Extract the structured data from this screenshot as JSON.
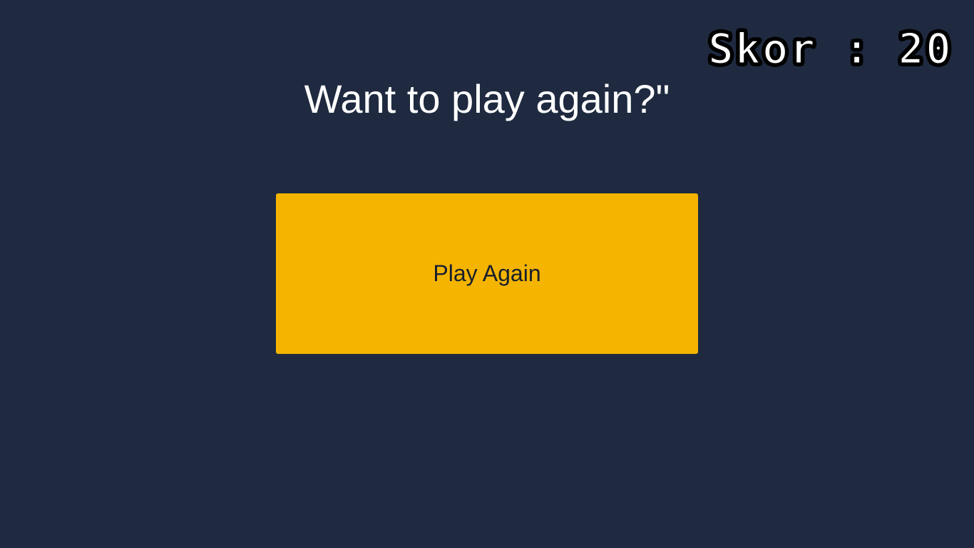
{
  "hud": {
    "score_text": "Skor : 20"
  },
  "dialog": {
    "title": "Want to play again?\"",
    "play_again_label": "Play Again"
  },
  "colors": {
    "background": "#1f2a40",
    "button": "#f4b400",
    "button_text": "#1a1f2e",
    "title_text": "#ffffff"
  }
}
